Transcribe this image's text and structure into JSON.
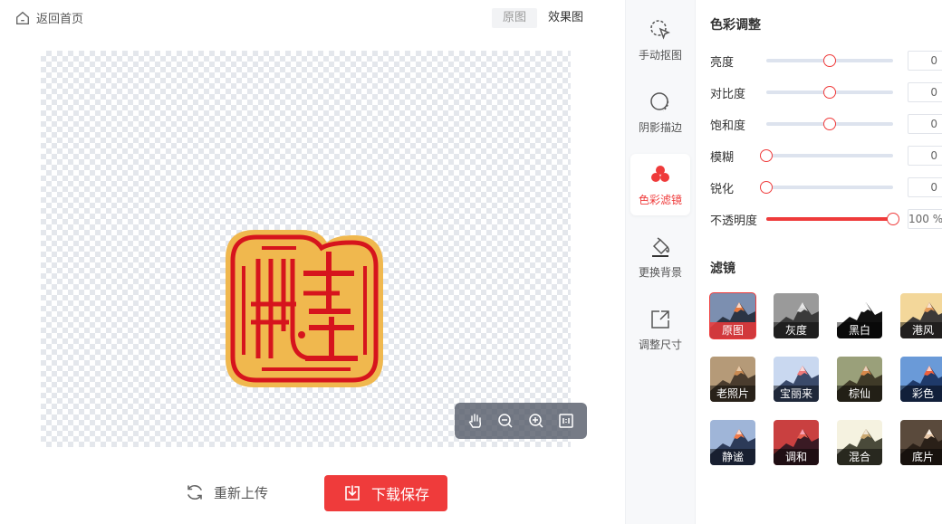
{
  "header": {
    "back_label": "返回首页",
    "view_tabs": [
      "原图",
      "效果图"
    ]
  },
  "preview": {
    "zoom_tools": [
      "hand-icon",
      "zoom-out-icon",
      "zoom-in-icon",
      "fit-icon"
    ]
  },
  "actions": {
    "reupload_label": "重新上传",
    "download_label": "下载保存"
  },
  "tools": [
    {
      "label": "手动抠图",
      "icon": "cursor-select-icon"
    },
    {
      "label": "阴影描边",
      "icon": "shadow-outline-icon"
    },
    {
      "label": "色彩滤镜",
      "icon": "color-filter-icon",
      "active": true
    },
    {
      "label": "更换背景",
      "icon": "paint-bucket-icon"
    },
    {
      "label": "调整尺寸",
      "icon": "resize-icon"
    }
  ],
  "adjust": {
    "title": "色彩调整",
    "rows": [
      {
        "label": "亮度",
        "value": "0",
        "level": 0.5
      },
      {
        "label": "对比度",
        "value": "0",
        "level": 0.5
      },
      {
        "label": "饱和度",
        "value": "0",
        "level": 0.5
      },
      {
        "label": "模糊",
        "value": "0",
        "level": 0
      },
      {
        "label": "锐化",
        "value": "0",
        "level": 0
      },
      {
        "label": "不透明度",
        "value": "100 %",
        "level": 1
      }
    ]
  },
  "filters": {
    "title": "滤镜",
    "items": [
      {
        "name": "原图",
        "selected": true
      },
      {
        "name": "灰度"
      },
      {
        "name": "黑白"
      },
      {
        "name": "港风"
      },
      {
        "name": "老照片"
      },
      {
        "name": "宝丽来"
      },
      {
        "name": "棕仙"
      },
      {
        "name": "彩色"
      },
      {
        "name": "静谧"
      },
      {
        "name": "调和"
      },
      {
        "name": "混合"
      },
      {
        "name": "底片"
      }
    ]
  },
  "colors": {
    "accent": "#ef3b3b",
    "seal_red": "#d6141d",
    "seal_gold": "#f0b84e"
  }
}
